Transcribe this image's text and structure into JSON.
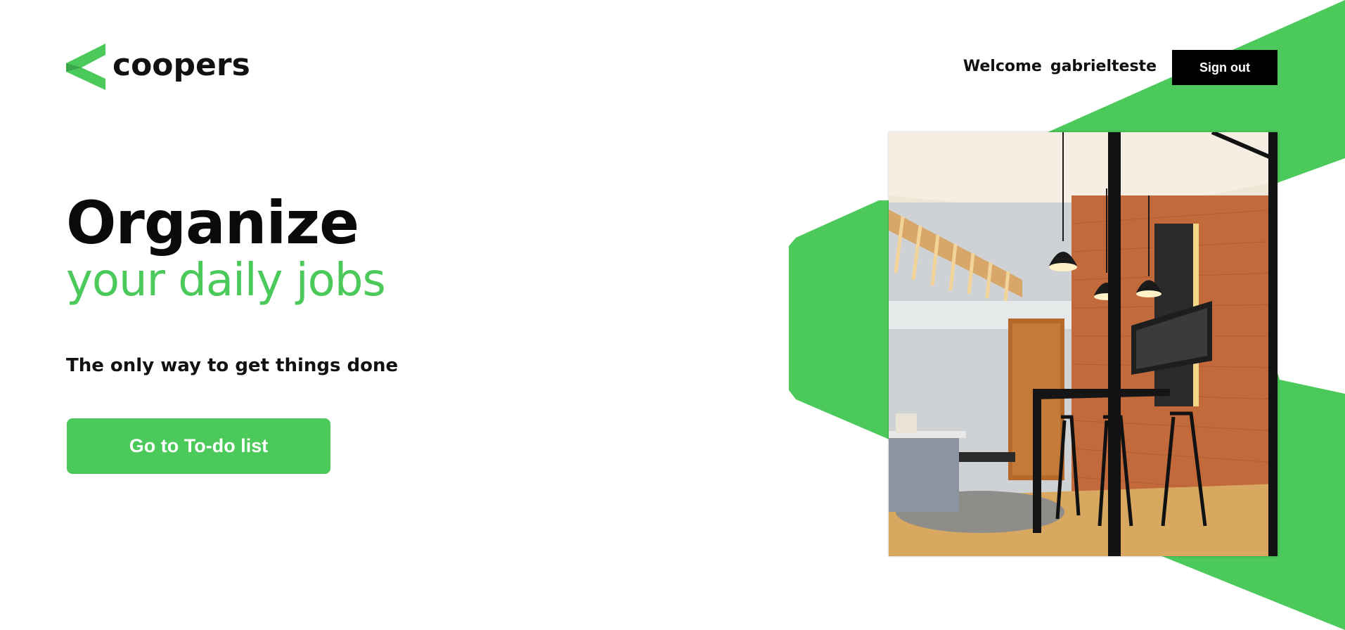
{
  "header": {
    "logo_text": "coopers",
    "welcome_label": "Welcome",
    "username": "gabrielteste",
    "signout_label": "Sign out"
  },
  "hero": {
    "title": "Organize",
    "subtitle": "your daily jobs",
    "tagline": "The only way to get things done",
    "cta_label": "Go to To-do list"
  },
  "photo": {
    "subject": "office kitchen with bar stools"
  },
  "colors": {
    "brand_green": "#4bc95a",
    "text_dark": "#111111",
    "signout_bg": "#000000"
  },
  "icons": {
    "logo": "coopers-chevron-logo"
  }
}
